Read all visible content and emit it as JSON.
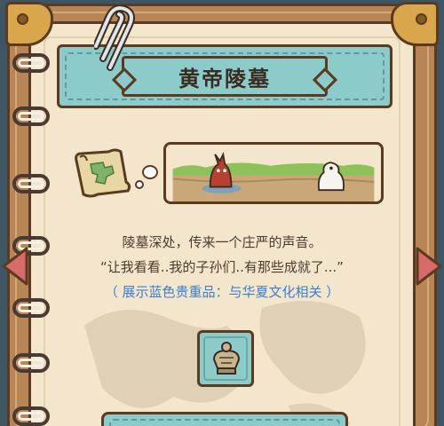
{
  "event": {
    "title": "黄帝陵墓",
    "description_line1": "陵墓深处，传来一个庄严的声音。",
    "description_line2": "“让我看看..我的子孙们..有那些成就了...”",
    "reward_note": "（ 展示蓝色贵重品：与华夏文化相关 ）"
  },
  "icons": {
    "scroll": "treasure-map-scroll-icon",
    "thought": "thought-bubble-icon",
    "reward": "bronze-relic-icon",
    "prev": "left-arrow-icon",
    "next": "right-arrow-icon",
    "clip": "paperclip-icon"
  },
  "colors": {
    "accent": "#8ccbc9",
    "outline": "#5b3a22",
    "paper": "#f3e6cc",
    "arrow": "#d86a6a",
    "note_text": "#3a7fd0"
  }
}
